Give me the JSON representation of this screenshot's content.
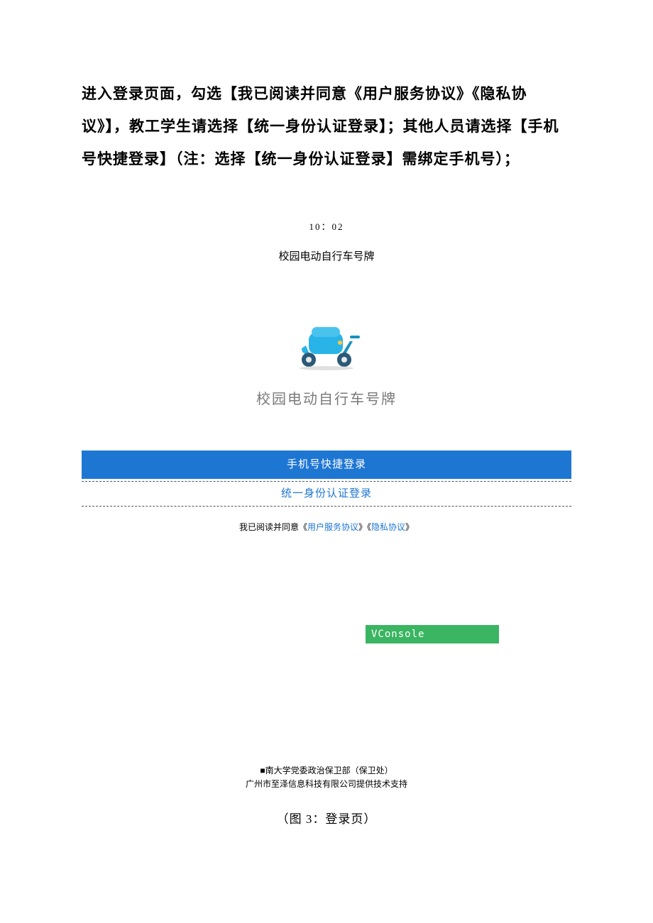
{
  "intro": "进入登录页面，勾选【我已阅读并同意《用户服务协议》《隐私协议》】，教工学生请选择【统一身份认证登录】；其他人员请选择【手机号快捷登录】（注：选择【统一身份认证登录】需绑定手机号）；",
  "screenshot": {
    "time": "10：02",
    "title": "校园电动自行车号牌",
    "app_name": "校园电动自行车号牌",
    "phone_login_label": "手机号快捷登录",
    "sso_login_label": "统一身份认证登录",
    "agree_prefix": "我已阅读并同意《",
    "link1": "用户服务协议",
    "mid": "》《",
    "link2": "隐私协议",
    "agree_suffix": "》",
    "vconsole": "VConsole",
    "footer_line1": "■南大学党委政治保卫部（保卫处）",
    "footer_line2": "广州市至泽信息科技有限公司提供技术支持"
  },
  "caption": "（图 3：登录页）"
}
